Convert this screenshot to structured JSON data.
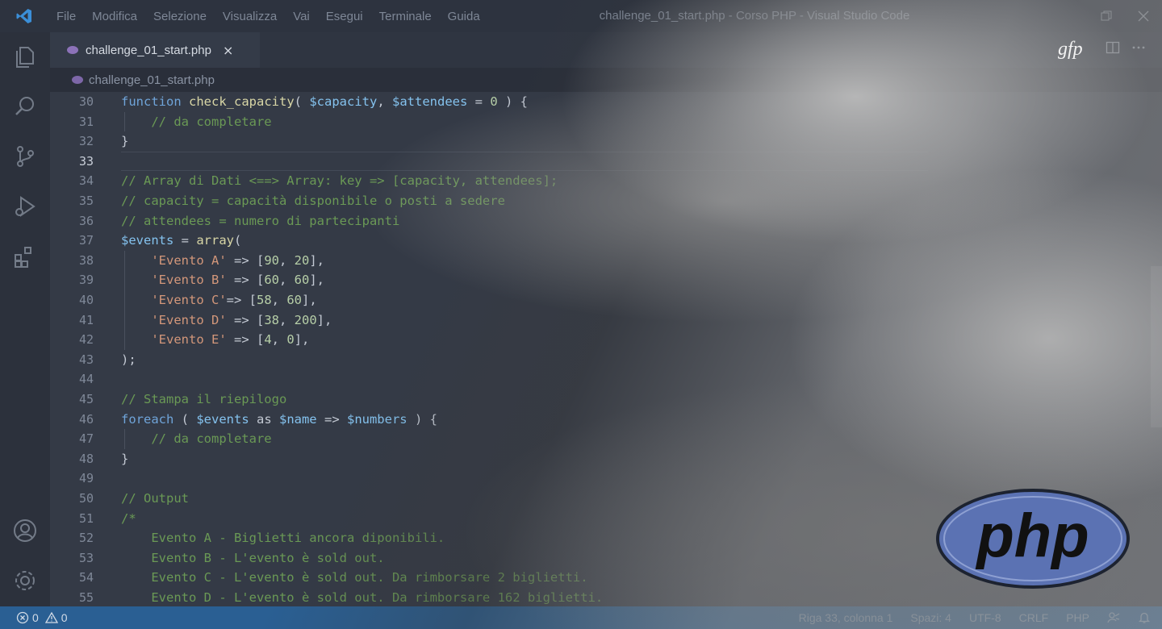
{
  "titlebar": {
    "app_icon": "vscode-logo-icon",
    "menu": [
      "File",
      "Modifica",
      "Selezione",
      "Visualizza",
      "Vai",
      "Esegui",
      "Terminale",
      "Guida"
    ],
    "window_title": "challenge_01_start.php - Corso PHP - Visual Studio Code",
    "controls": [
      "restore-icon",
      "close-icon"
    ]
  },
  "activitybar": {
    "top": [
      "explorer-icon",
      "search-icon",
      "source-control-icon",
      "run-debug-icon",
      "extensions-icon"
    ],
    "bottom": [
      "account-icon",
      "gear-icon"
    ]
  },
  "tab": {
    "label": "challenge_01_start.php",
    "close": "×",
    "icon": "php-file-icon"
  },
  "breadcrumb": {
    "label": "challenge_01_start.php",
    "icon": "php-file-icon"
  },
  "editor_actions": [
    "split-editor-icon",
    "more-actions-icon"
  ],
  "code_lines": [
    {
      "n": "30",
      "tokens": [
        {
          "t": "function",
          "c": "kw"
        },
        {
          "t": " "
        },
        {
          "t": "check_capacity",
          "c": "fn"
        },
        {
          "t": "( "
        },
        {
          "t": "$capacity",
          "c": "var"
        },
        {
          "t": ", "
        },
        {
          "t": "$attendees",
          "c": "var"
        },
        {
          "t": " = "
        },
        {
          "t": "0",
          "c": "num"
        },
        {
          "t": " ) {"
        }
      ]
    },
    {
      "n": "31",
      "tokens": [
        {
          "t": "    "
        },
        {
          "t": "// da completare",
          "c": "com"
        }
      ]
    },
    {
      "n": "32",
      "tokens": [
        {
          "t": "}"
        }
      ]
    },
    {
      "n": "33",
      "tokens": []
    },
    {
      "n": "34",
      "tokens": [
        {
          "t": "// Array di Dati <==> Array: key => [capacity, attendees];",
          "c": "com"
        }
      ]
    },
    {
      "n": "35",
      "tokens": [
        {
          "t": "// capacity = capacità disponibile o posti a sedere",
          "c": "com"
        }
      ]
    },
    {
      "n": "36",
      "tokens": [
        {
          "t": "// attendees = numero di partecipanti",
          "c": "com"
        }
      ]
    },
    {
      "n": "37",
      "tokens": [
        {
          "t": "$events",
          "c": "var"
        },
        {
          "t": " = "
        },
        {
          "t": "array",
          "c": "fn"
        },
        {
          "t": "("
        }
      ]
    },
    {
      "n": "38",
      "tokens": [
        {
          "t": "    "
        },
        {
          "t": "'Evento A'",
          "c": "str"
        },
        {
          "t": " => ["
        },
        {
          "t": "90",
          "c": "num"
        },
        {
          "t": ", "
        },
        {
          "t": "20",
          "c": "num"
        },
        {
          "t": "],"
        }
      ]
    },
    {
      "n": "39",
      "tokens": [
        {
          "t": "    "
        },
        {
          "t": "'Evento B'",
          "c": "str"
        },
        {
          "t": " => ["
        },
        {
          "t": "60",
          "c": "num"
        },
        {
          "t": ", "
        },
        {
          "t": "60",
          "c": "num"
        },
        {
          "t": "],"
        }
      ]
    },
    {
      "n": "40",
      "tokens": [
        {
          "t": "    "
        },
        {
          "t": "'Evento C'",
          "c": "str"
        },
        {
          "t": "=> ["
        },
        {
          "t": "58",
          "c": "num"
        },
        {
          "t": ", "
        },
        {
          "t": "60",
          "c": "num"
        },
        {
          "t": "],"
        }
      ]
    },
    {
      "n": "41",
      "tokens": [
        {
          "t": "    "
        },
        {
          "t": "'Evento D'",
          "c": "str"
        },
        {
          "t": " => ["
        },
        {
          "t": "38",
          "c": "num"
        },
        {
          "t": ", "
        },
        {
          "t": "200",
          "c": "num"
        },
        {
          "t": "],"
        }
      ]
    },
    {
      "n": "42",
      "tokens": [
        {
          "t": "    "
        },
        {
          "t": "'Evento E'",
          "c": "str"
        },
        {
          "t": " => ["
        },
        {
          "t": "4",
          "c": "num"
        },
        {
          "t": ", "
        },
        {
          "t": "0",
          "c": "num"
        },
        {
          "t": "],"
        }
      ]
    },
    {
      "n": "43",
      "tokens": [
        {
          "t": ");"
        }
      ]
    },
    {
      "n": "44",
      "tokens": []
    },
    {
      "n": "45",
      "tokens": [
        {
          "t": "// Stampa il riepilogo",
          "c": "com"
        }
      ]
    },
    {
      "n": "46",
      "tokens": [
        {
          "t": "foreach",
          "c": "kw"
        },
        {
          "t": " ( "
        },
        {
          "t": "$events",
          "c": "var"
        },
        {
          "t": " as "
        },
        {
          "t": "$name",
          "c": "var"
        },
        {
          "t": " => "
        },
        {
          "t": "$numbers",
          "c": "var"
        },
        {
          "t": " ) {"
        }
      ]
    },
    {
      "n": "47",
      "tokens": [
        {
          "t": "    "
        },
        {
          "t": "// da completare",
          "c": "com"
        }
      ]
    },
    {
      "n": "48",
      "tokens": [
        {
          "t": "}"
        }
      ]
    },
    {
      "n": "49",
      "tokens": []
    },
    {
      "n": "50",
      "tokens": [
        {
          "t": "// Output",
          "c": "com"
        }
      ]
    },
    {
      "n": "51",
      "tokens": [
        {
          "t": "/*",
          "c": "com"
        }
      ]
    },
    {
      "n": "52",
      "tokens": [
        {
          "t": "    Evento A - Biglietti ancora diponibili.",
          "c": "com"
        }
      ]
    },
    {
      "n": "53",
      "tokens": [
        {
          "t": "    Evento B - L'evento è sold out.",
          "c": "com"
        }
      ]
    },
    {
      "n": "54",
      "tokens": [
        {
          "t": "    Evento C - L'evento è sold out. Da rimborsare 2 biglietti.",
          "c": "com"
        }
      ]
    },
    {
      "n": "55",
      "tokens": [
        {
          "t": "    Evento D - L'evento è sold out. Da rimborsare 162 biglietti.",
          "c": "com"
        }
      ]
    }
  ],
  "current_line": "33",
  "statusbar": {
    "errors": "0",
    "warnings": "0",
    "position": "Riga 33, colonna 1",
    "spaces": "Spazi: 4",
    "encoding": "UTF-8",
    "eol": "CRLF",
    "language": "PHP",
    "icons": [
      "error-icon",
      "warning-icon",
      "feedback-icon",
      "bell-icon"
    ]
  },
  "logos": {
    "php": "php",
    "signature": "gfp"
  },
  "colors": {
    "statusbar": "#2a5f93",
    "keyword": "#6fa4d9",
    "variable": "#84c2ee",
    "string": "#d3977a",
    "comment": "#6a9955",
    "php_logo": "#5b72b3"
  }
}
